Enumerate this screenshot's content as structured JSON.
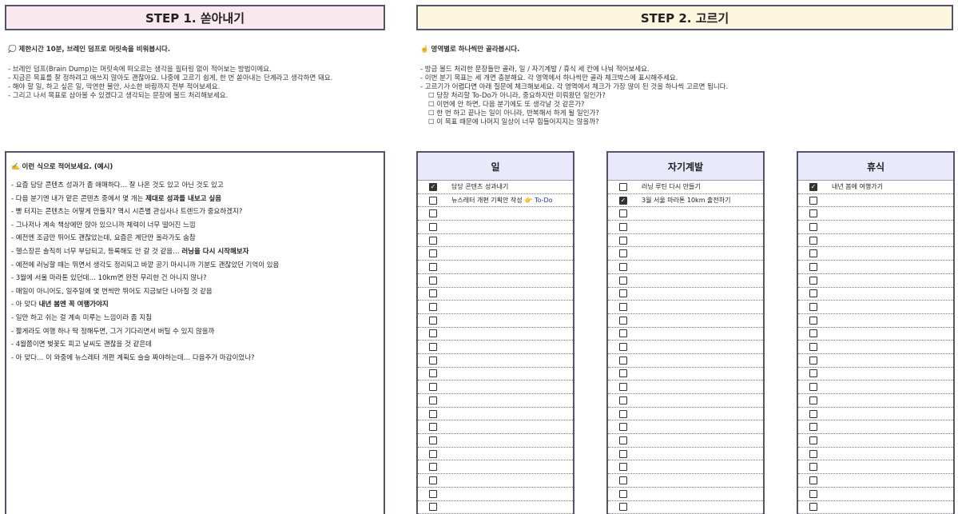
{
  "step1": {
    "header": "STEP 1. 쏟아내기",
    "intro_title": "💭 제한시간 10분, 브레인 덤프로 머릿속을 비워봅시다.",
    "intro_lines": [
      "- 브레인 덤프(Brain Dump)는 머릿속에 떠오르는 생각을 필터링 없이 적어보는 방법이에요.",
      "- 지금은 목표를 잘 정하려고 애쓰지 않아도 괜찮아요. 나중에 고르기 쉽게, 한 번 쏟아내는 단계라고 생각하면 돼요.",
      "- 해야 할 일, 하고 싶은 일, 막연한 불안, 사소한 바람까지 전부 적어보세요.",
      "- 그리고 나서 목표로 삼아볼 수 있겠다고 생각되는 문장에 볼드 처리해보세요."
    ]
  },
  "step2": {
    "header": "STEP 2. 고르기",
    "intro_title": "☝️ 영역별로 하나씩만 골라봅시다.",
    "intro_lines": [
      "- 방금 볼드 처리한 문장들만 골라, 일 / 자기계발 / 휴식 세 칸에 나눠 적어보세요.",
      "- 이번 분기 목표는 세 개면 충분해요. 각 영역에서 하나씩만 골라 체크박스에 표시해주세요.",
      "- 고르기가 어렵다면 아래 질문에 체크해보세요. 각 영역에서 체크가 가장 많이 된 것을 하나씩 고르면 됩니다."
    ],
    "questions": [
      "☐ 당장 처리할 To-Do가 아니라, 중요하지만 미뤄왔던 일인가?",
      "☐ 이번에 안 하면, 다음 분기에도 또 생각날 것 같은가?",
      "☐ 한 번 하고 끝나는 일이 아니라, 반복해서 하게 될 일인가?",
      "☐ 이 목표 때문에 나머지 일상이 너무 힘들어지지는 않을까?"
    ]
  },
  "example": {
    "title": "✍️ 이런 식으로 적어보세요. (예시)",
    "items": [
      [
        {
          "t": "- 요즘 담당 콘텐츠 성과가 좀 애매하다… 잘 나온 것도 있고 아닌 것도 있고"
        }
      ],
      [
        {
          "t": "- 다음 분기엔 내가 맡은 콘텐츠 중에서 몇 개는 "
        },
        {
          "t": "제대로 성과를 내보고 싶음",
          "b": true
        }
      ],
      [
        {
          "t": "- 빵 터지는 콘텐츠는 어떻게 만들지? 역시 시즌별 관심사나 트렌드가 중요하겠지?"
        }
      ],
      [
        {
          "t": "- 그나저나 계속 책상에만 앉아 있으니까 체력이 너무 떨어진 느낌"
        }
      ],
      [
        {
          "t": "- 예전엔 조금만 뛰어도 괜찮았는데, 요즘은 계단만 올라가도 숨참"
        }
      ],
      [
        {
          "t": "- 헬스장은 솔직히 너무 부담되고, 등록해도 안 갈 것 같음… "
        },
        {
          "t": "러닝을 다시 시작해보자",
          "b": true
        }
      ],
      [
        {
          "t": "- 예전에 러닝할 때는 뛰면서 생각도 정리되고 바깥 공기 마시니까 기분도 괜찮았던 기억이 있음"
        }
      ],
      [
        {
          "t": "- 3월에 서울 마라톤 있던데… 10km면 완전 무리한 건 아니지 않나?"
        }
      ],
      [
        {
          "t": "- 매일이 아니어도, 일주일에 몇 번씩만 뛰어도 지금보단 나아질 것 같음"
        }
      ],
      [
        {
          "t": "- 아 맞다 "
        },
        {
          "t": "내년 봄엔 꼭 여행가야지",
          "b": true
        }
      ],
      [
        {
          "t": "- 일만 하고 쉬는 걸 계속 미루는 느낌이라 좀 지침"
        }
      ],
      [
        {
          "t": "- 짧게라도 여행 하나 딱 정해두면, 그거 기다리면서 버틸 수 있지 않을까"
        }
      ],
      [
        {
          "t": "- 4월쯤이면 벚꽃도 피고 날씨도 괜찮을 것 같은데"
        }
      ],
      [
        {
          "t": "- 아 맞다… 이 와중에 뉴스레터 개편 계획도 슬슬 짜야하는데… 다음주가 마감이었나?"
        }
      ]
    ]
  },
  "columns": [
    {
      "title": "일",
      "rows": [
        {
          "checked": true,
          "text": "담당 콘텐츠 성과내기"
        },
        {
          "checked": false,
          "text": "뉴스레터 개편 기획안 작성",
          "todo": "👉 To-Do"
        }
      ]
    },
    {
      "title": "자기계발",
      "rows": [
        {
          "checked": false,
          "text": "러닝 루틴 다시 만들기"
        },
        {
          "checked": true,
          "text": "3월 서울 마라톤 10km 출전하기"
        }
      ]
    },
    {
      "title": "휴식",
      "rows": [
        {
          "checked": true,
          "text": "내년 봄에 여행가기"
        }
      ]
    }
  ],
  "rows_per_column": 25,
  "colors": {
    "step1_header_bg": "#f8e9ee",
    "step2_header_bg": "#fdf6de",
    "column_header_bg": "#e9e9fb",
    "border": "#55526e",
    "todo_link": "#2431d8"
  }
}
